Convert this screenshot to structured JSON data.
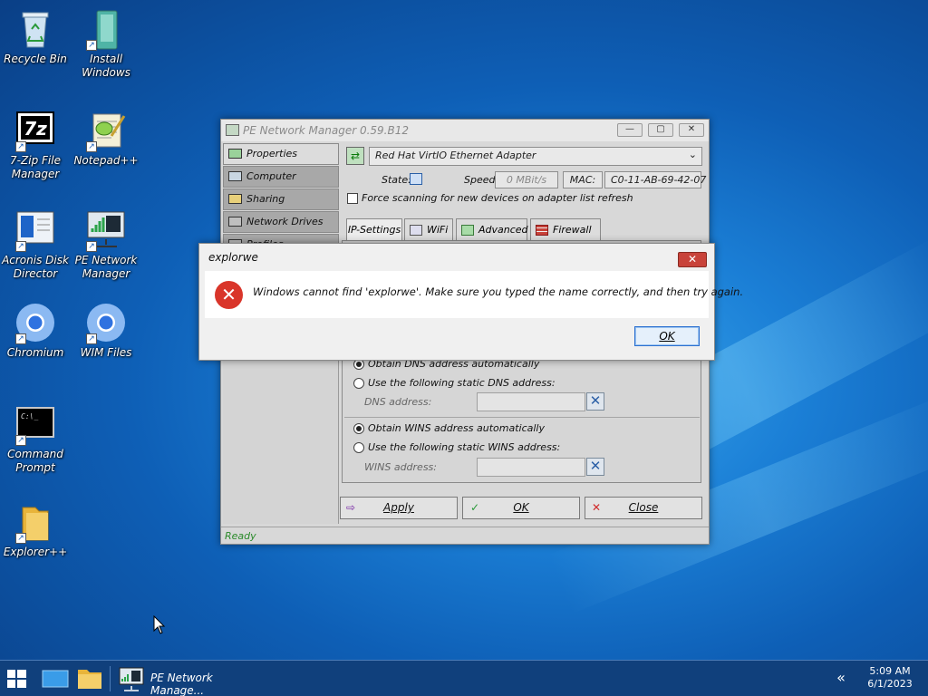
{
  "desktop": {
    "icons": [
      {
        "label_line1": "Recycle Bin",
        "label_line2": "",
        "icon": "recycle-bin-icon"
      },
      {
        "label_line1": "Install",
        "label_line2": "Windows",
        "icon": "install-windows-icon"
      },
      {
        "label_line1": "7-Zip File",
        "label_line2": "Manager",
        "icon": "7zip-icon"
      },
      {
        "label_line1": "Notepad++",
        "label_line2": "",
        "icon": "notepadpp-icon"
      },
      {
        "label_line1": "Acronis Disk",
        "label_line2": "Director",
        "icon": "acronis-icon"
      },
      {
        "label_line1": "PE Network",
        "label_line2": "Manager",
        "icon": "pe-network-manager-icon"
      },
      {
        "label_line1": "Chromium",
        "label_line2": "",
        "icon": "chromium-icon"
      },
      {
        "label_line1": "WIM Files",
        "label_line2": "",
        "icon": "wim-files-icon"
      },
      {
        "label_line1": "Command",
        "label_line2": "Prompt",
        "icon": "command-prompt-icon"
      },
      {
        "label_line1": "Explorer++",
        "label_line2": "",
        "icon": "explorerpp-icon"
      }
    ]
  },
  "netmgr": {
    "title": "PE Network Manager 0.59.B12",
    "nav": [
      "Properties",
      "Computer",
      "Sharing",
      "Network Drives",
      "Profiles"
    ],
    "adapter": "Red Hat VirtIO Ethernet Adapter",
    "state_label": "State:",
    "speed_label": "Speed:",
    "speed_value": "0 MBit/s",
    "mac_label": "MAC:",
    "mac_value": "C0-11-AB-69-42-07",
    "force_scan_label": "Force scanning for new devices on adapter list refresh",
    "tabs": [
      "IP-Settings",
      "WiFi",
      "Advanced",
      "Firewall"
    ],
    "dns_auto": "Obtain DNS address automatically",
    "dns_static": "Use the following static DNS address:",
    "dns_address_label": "DNS address:",
    "wins_auto": "Obtain WINS address automatically",
    "wins_static": "Use the following static WINS address:",
    "wins_address_label": "WINS address:",
    "buttons": {
      "apply": "Apply",
      "ok": "OK",
      "close": "Close"
    },
    "status": "Ready"
  },
  "dialog": {
    "title": "explorwe",
    "message": "Windows cannot find 'explorwe'. Make sure you typed the name correctly, and then try again.",
    "ok": "OK"
  },
  "taskbar": {
    "task_label": "PE Network Manage...",
    "time": "5:09 AM",
    "date": "6/1/2023"
  },
  "colors": {
    "accent": "#0e5fb6",
    "taskbar": "#10407c",
    "error_red": "#d9352a",
    "close_red": "#c8433a"
  }
}
